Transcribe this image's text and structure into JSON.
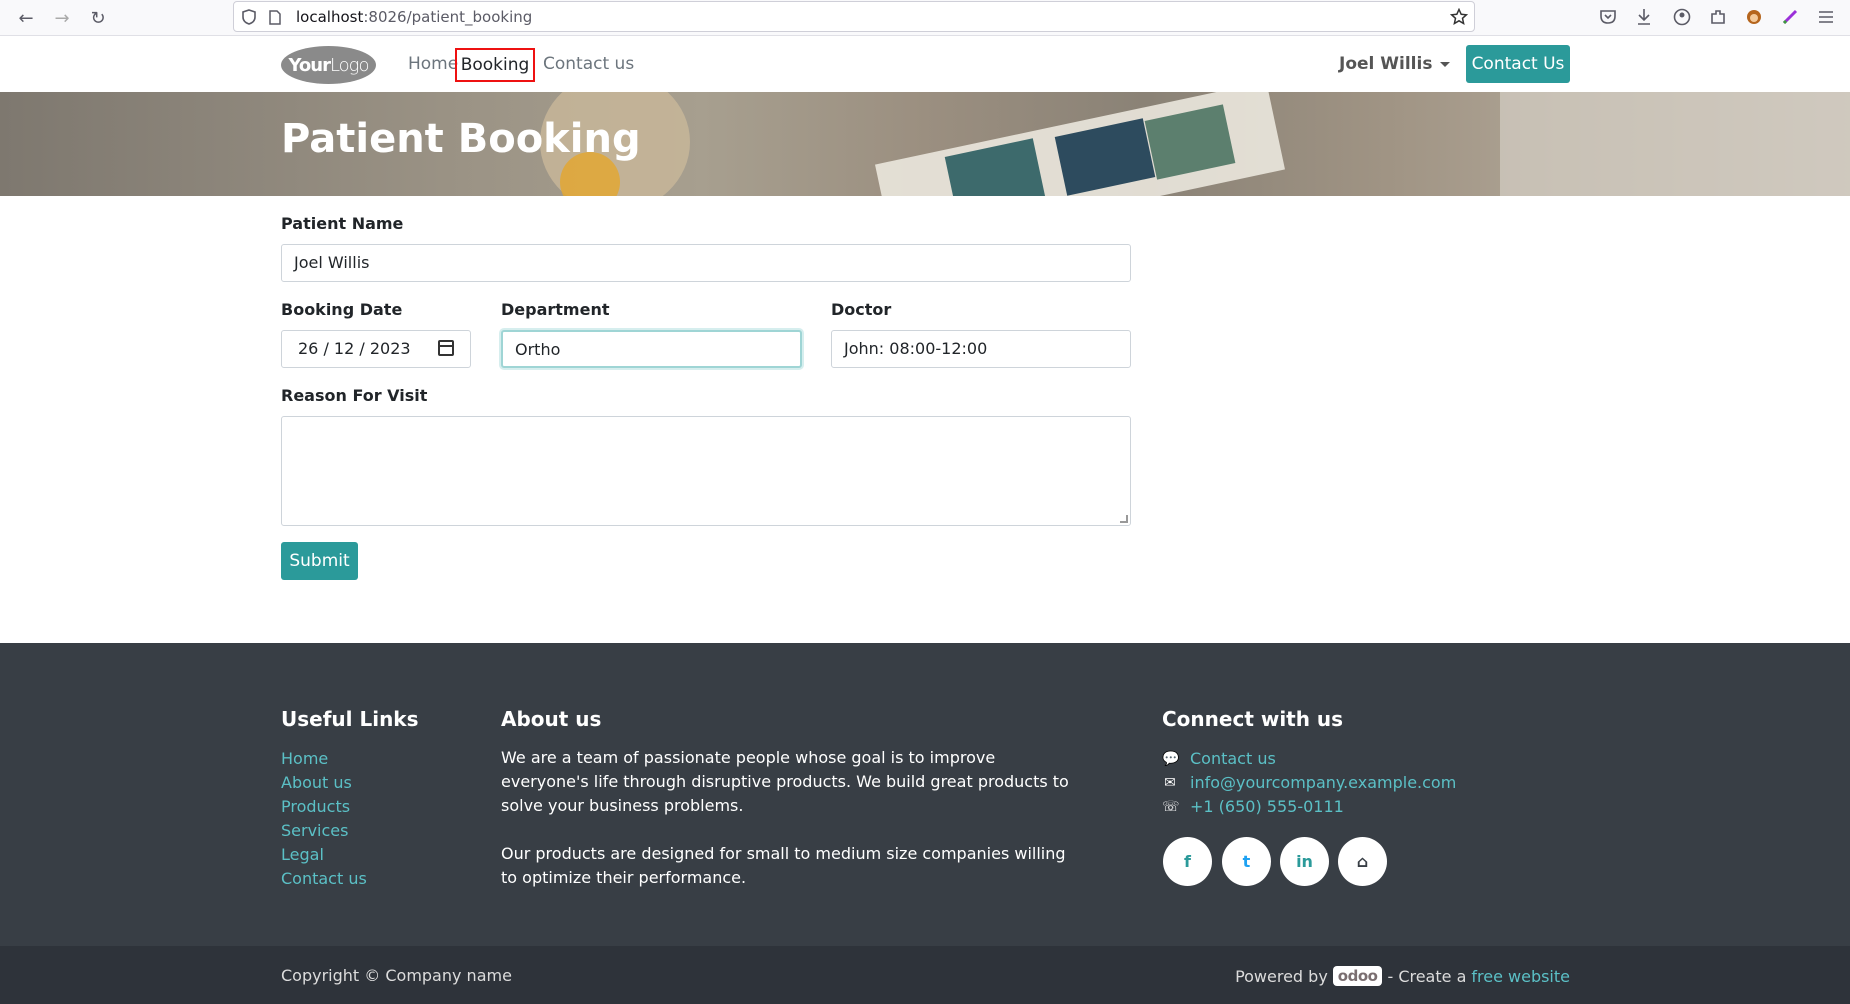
{
  "browser": {
    "url_host": "localhost",
    "url_rest": ":8026/patient_booking"
  },
  "header": {
    "logo_bold": "Your",
    "logo_light": "Logo",
    "menu": [
      "Home",
      "Booking",
      "Contact us"
    ],
    "user_name": "Joel Willis",
    "contact_button": "Contact Us"
  },
  "banner": {
    "title": "Patient Booking"
  },
  "form": {
    "patient_name_label": "Patient Name",
    "patient_name_value": "Joel Willis",
    "booking_date_label": "Booking Date",
    "booking_date_value": "26 / 12 / 2023",
    "department_label": "Department",
    "department_value": "Ortho",
    "doctor_label": "Doctor",
    "doctor_value": "John: 08:00-12:00",
    "reason_label": "Reason For Visit",
    "submit_label": "Submit"
  },
  "footer": {
    "useful_links_title": "Useful Links",
    "useful_links": [
      "Home",
      "About us",
      "Products",
      "Services",
      "Legal",
      "Contact us"
    ],
    "about_title": "About us",
    "about_p1_l1": "We are a team of passionate people whose goal is to improve",
    "about_p1_l2": "everyone's life through disruptive products. We build great products to",
    "about_p1_l3": "solve your business problems.",
    "about_p2_l1": "Our products are designed for small to medium size companies willing",
    "about_p2_l2": "to optimize their performance.",
    "connect_title": "Connect with us",
    "contact_us": "Contact us",
    "email": "info@yourcompany.example.com",
    "phone": "+1 (650) 555-0111",
    "social": [
      "f",
      "t",
      "in",
      "⌂"
    ]
  },
  "bottom": {
    "copyright": "Copyright © Company name",
    "powered_by": "Powered by",
    "odoo": "odoo",
    "create_a": "- Create a",
    "free_website": "free website"
  },
  "colors": {
    "accent": "#2b9a9a",
    "footer_bg": "#383e45",
    "link": "#5bc0c6"
  }
}
